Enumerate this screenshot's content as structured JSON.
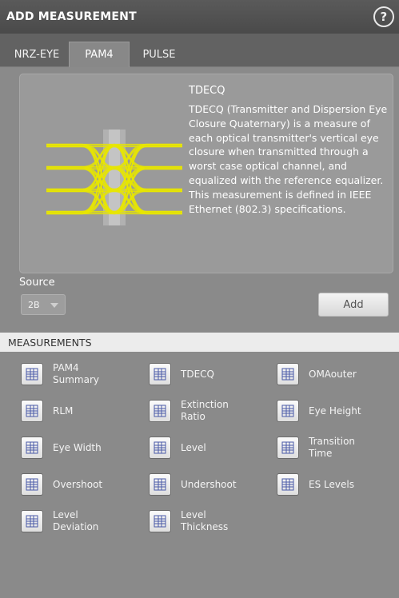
{
  "window": {
    "title": "ADD MEASUREMENT",
    "help_symbol": "?"
  },
  "tabs": [
    {
      "label": "NRZ-EYE",
      "active": false
    },
    {
      "label": "PAM4",
      "active": true
    },
    {
      "label": "PULSE",
      "active": false
    }
  ],
  "description": {
    "title": "TDECQ",
    "text": "TDECQ (Transmitter and Dispersion Eye Closure Quaternary) is a measure of each optical transmitter's vertical eye closure when transmitted through a worst case optical channel, and equalized with the reference equalizer. This measurement is defined in IEEE Ethernet (802.3) specifications.",
    "eye_color": "#e8e600"
  },
  "source": {
    "label": "Source",
    "value": "2B"
  },
  "add_label": "Add",
  "measurements_header": "MEASUREMENTS",
  "measurements": [
    {
      "label": "PAM4 Summary",
      "icon": "pam4-summary-icon"
    },
    {
      "label": "TDECQ",
      "icon": "tdecq-icon"
    },
    {
      "label": "OMAouter",
      "icon": "omaouter-icon"
    },
    {
      "label": "RLM",
      "icon": "rlm-icon"
    },
    {
      "label": "Extinction Ratio",
      "icon": "extinction-ratio-icon"
    },
    {
      "label": "Eye Height",
      "icon": "eye-height-icon"
    },
    {
      "label": "Eye Width",
      "icon": "eye-width-icon"
    },
    {
      "label": "Level",
      "icon": "level-icon"
    },
    {
      "label": "Transition Time",
      "icon": "transition-time-icon"
    },
    {
      "label": "Overshoot",
      "icon": "overshoot-icon"
    },
    {
      "label": "Undershoot",
      "icon": "undershoot-icon"
    },
    {
      "label": "ES Levels",
      "icon": "es-levels-icon"
    },
    {
      "label": "Level Deviation",
      "icon": "level-deviation-icon"
    },
    {
      "label": "Level Thickness",
      "icon": "level-thickness-icon"
    }
  ],
  "colors": {
    "titlebar": "#4e4e4e",
    "panel": "#8a8a8a",
    "header_bar": "#ececec",
    "icon_accent": "#4a5aa8"
  }
}
